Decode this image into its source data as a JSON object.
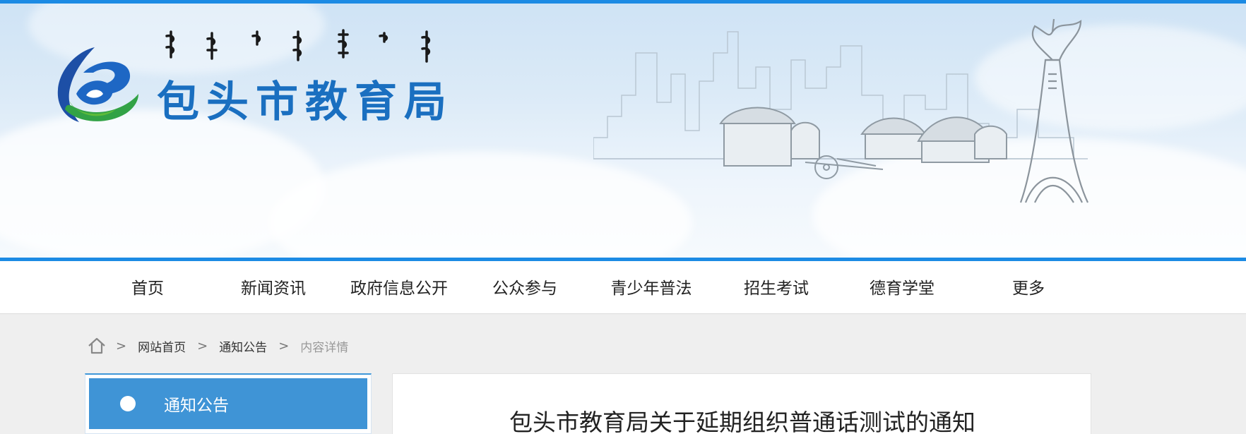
{
  "header": {
    "site_title": "包头市教育局",
    "logo_icon": "education-bureau-logo-icon",
    "mongolian_title_icon": "mongolian-script-title-icon",
    "skyline_icon": "city-skyline-yurts-monument-illustration",
    "accent_color": "#1c8be4"
  },
  "nav": {
    "items": [
      {
        "label": "首页"
      },
      {
        "label": "新闻资讯"
      },
      {
        "label": "政府信息公开"
      },
      {
        "label": "公众参与"
      },
      {
        "label": "青少年普法"
      },
      {
        "label": "招生考试"
      },
      {
        "label": "德育学堂"
      },
      {
        "label": "更多"
      }
    ]
  },
  "breadcrumb": {
    "home_icon": "home-icon",
    "separator": ">",
    "items": [
      {
        "label": "网站首页"
      },
      {
        "label": "通知公告"
      },
      {
        "label": "内容详情"
      }
    ]
  },
  "sidebar": {
    "active_item": "通知公告",
    "active_color": "#3f94d6"
  },
  "article": {
    "title": "包头市教育局关于延期组织普通话测试的通知"
  }
}
